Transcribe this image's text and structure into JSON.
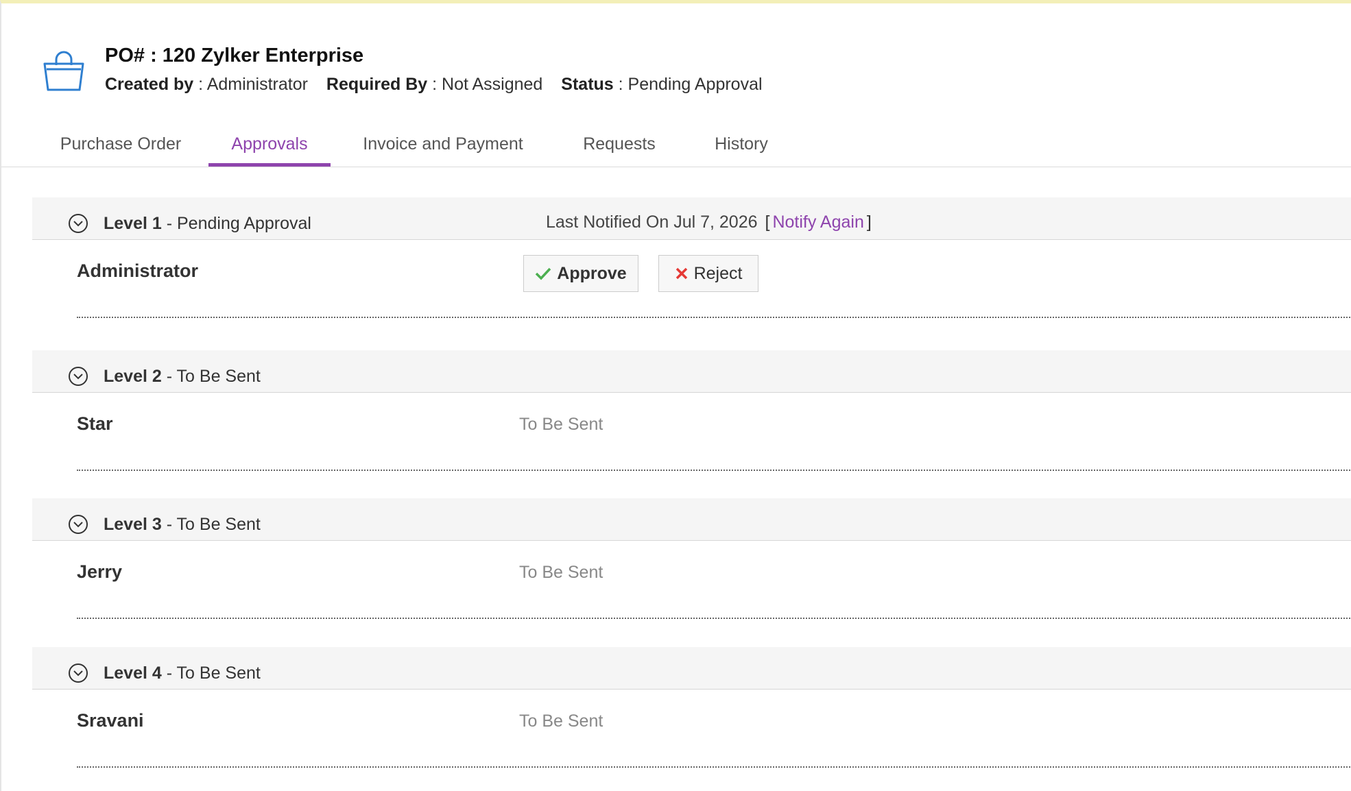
{
  "header": {
    "icon": "shopping-basket-icon",
    "title": "PO# : 120 Zylker Enterprise",
    "created_by_label": "Created by",
    "created_by_value": "Administrator",
    "required_by_label": "Required By",
    "required_by_value": "Not Assigned",
    "status_label": "Status",
    "status_value": "Pending Approval"
  },
  "tabs": [
    {
      "label": "Purchase Order",
      "active": false
    },
    {
      "label": "Approvals",
      "active": true
    },
    {
      "label": "Invoice and Payment",
      "active": false
    },
    {
      "label": "Requests",
      "active": false
    },
    {
      "label": "History",
      "active": false
    }
  ],
  "colors": {
    "accent": "#8e44ad",
    "approve_check": "#4caf50",
    "reject_x": "#e53935",
    "icon_blue": "#2f7fd0"
  },
  "levels": [
    {
      "name": "Level 1",
      "state": "Pending Approval",
      "last_notified_label": "Last Notified On Jul 7, 2026",
      "notify_again_label": "Notify Again",
      "approver": "Administrator",
      "approve_label": "Approve",
      "reject_label": "Reject"
    },
    {
      "name": "Level 2",
      "state": "To Be Sent",
      "approver": "Star",
      "approver_status": "To Be Sent"
    },
    {
      "name": "Level 3",
      "state": "To Be Sent",
      "approver": "Jerry",
      "approver_status": "To Be Sent"
    },
    {
      "name": "Level 4",
      "state": "To Be Sent",
      "approver": "Sravani",
      "approver_status": "To Be Sent"
    }
  ]
}
